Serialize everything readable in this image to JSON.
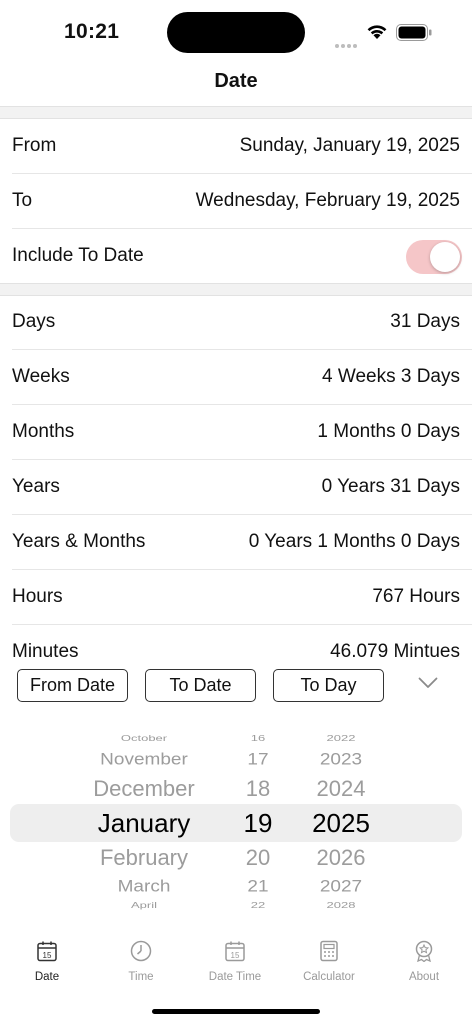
{
  "status": {
    "time": "10:21"
  },
  "nav": {
    "title": "Date"
  },
  "inputs": {
    "from_label": "From",
    "from_value": "Sunday, January 19, 2025",
    "to_label": "To",
    "to_value": "Wednesday, February 19, 2025",
    "include_label": "Include To Date",
    "include_on": true
  },
  "results": [
    {
      "label": "Days",
      "value": "31 Days"
    },
    {
      "label": "Weeks",
      "value": "4 Weeks 3 Days"
    },
    {
      "label": "Months",
      "value": "1 Months 0 Days"
    },
    {
      "label": "Years",
      "value": "0 Years 31 Days"
    },
    {
      "label": "Years & Months",
      "value": "0 Years 1 Months 0 Days"
    },
    {
      "label": "Hours",
      "value": "767 Hours"
    },
    {
      "label": "Minutes",
      "value": "46,079 Mintues"
    }
  ],
  "buttons": {
    "from_date": "From Date",
    "to_date": "To Date",
    "to_day": "To Day"
  },
  "picker": {
    "months": [
      "October",
      "November",
      "December",
      "January",
      "February",
      "March",
      "April"
    ],
    "days": [
      "16",
      "17",
      "18",
      "19",
      "20",
      "21",
      "22"
    ],
    "years": [
      "2022",
      "2023",
      "2024",
      "2025",
      "2026",
      "2027",
      "2028"
    ],
    "selected": {
      "month": "January",
      "day": "19",
      "year": "2025"
    }
  },
  "tabs": [
    {
      "label": "Date",
      "icon": "calendar-icon",
      "active": true
    },
    {
      "label": "Time",
      "icon": "clock-icon",
      "active": false
    },
    {
      "label": "Date Time",
      "icon": "calendar-icon",
      "active": false
    },
    {
      "label": "Calculator",
      "icon": "calculator-icon",
      "active": false
    },
    {
      "label": "About",
      "icon": "badge-icon",
      "active": false
    }
  ],
  "colors": {
    "toggle_on": "#f5c6c8",
    "active_tab": "#222222",
    "inactive_tab": "#9a9a9a"
  }
}
